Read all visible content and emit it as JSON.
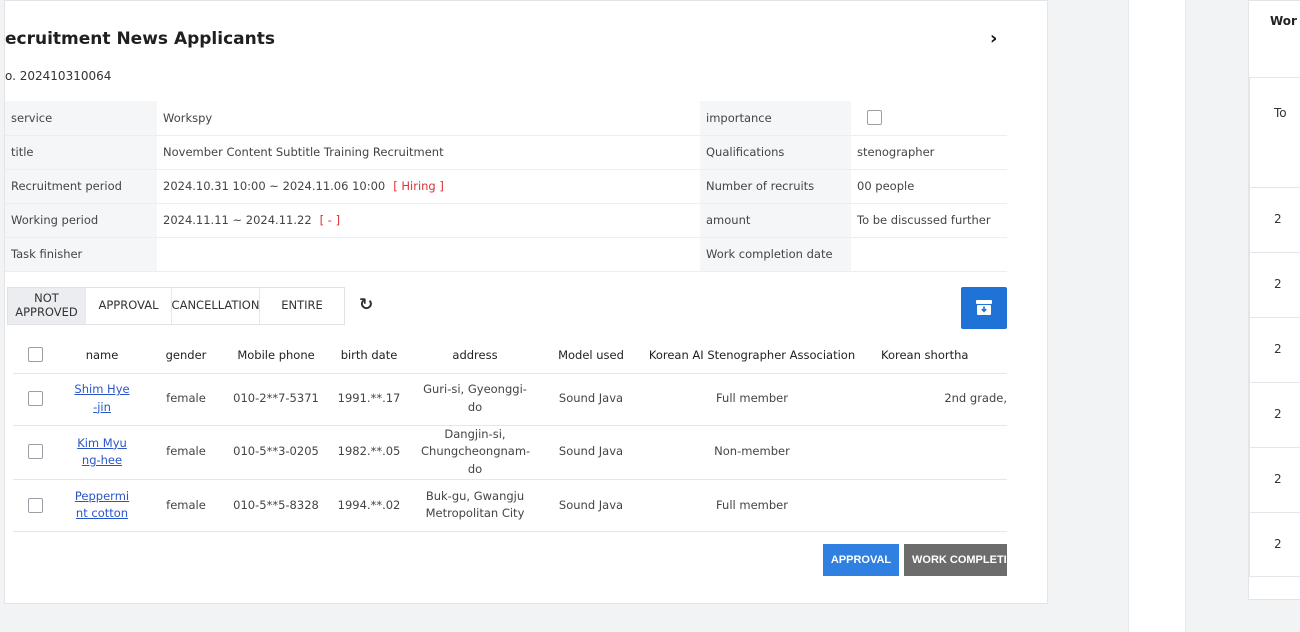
{
  "dialog": {
    "title": "ecruitment News Applicants",
    "request_no": "o. 202410310064",
    "close_icon": "close-icon"
  },
  "info": {
    "rows": [
      {
        "label": "service",
        "value": "Workspy",
        "right_label": "importance",
        "right_value": ""
      },
      {
        "label": "title",
        "value": "November Content Subtitle Training Recruitment",
        "right_label": "Qualifications",
        "right_value": "stenographer"
      },
      {
        "label": "Recruitment period",
        "value": "2024.10.31 10:00 ~ 2024.11.06 10:00",
        "tag": "[ Hiring ]",
        "right_label": "Number of recruits",
        "right_value": "00 people"
      },
      {
        "label": "Working period",
        "value": "2024.11.11 ~ 2024.11.22",
        "tag": "[ - ]",
        "right_label": "amount",
        "right_value": "To be discussed further"
      },
      {
        "label": "Task finisher",
        "value": "",
        "right_label": "Work completion date",
        "right_value": ""
      }
    ],
    "importance_checked": false
  },
  "filter_tabs": [
    {
      "label": "NOT APPROVED",
      "active": true
    },
    {
      "label": "APPROVAL",
      "active": false
    },
    {
      "label": "CANCELLATION",
      "active": false
    },
    {
      "label": "ENTIRE",
      "active": false
    }
  ],
  "refresh_icon": "refresh-icon",
  "download_icon": "archive-download-icon",
  "download_color": "#1f73d6",
  "applicants": {
    "columns": [
      "name",
      "gender",
      "Mobile phone",
      "birth date",
      "address",
      "Model used",
      "Korean AI Stenographer Association",
      "Korean shortha"
    ],
    "rows": [
      {
        "name": "Shim Hye-jin",
        "gender": "female",
        "phone": "010-2**7-5371",
        "birth": "1991.**.17",
        "address": "Guri-si, Gyeonggi-do",
        "model": "Sound Java",
        "association": "Full member",
        "shorthand": "2nd grade,"
      },
      {
        "name": "Kim Myung-hee",
        "gender": "female",
        "phone": "010-5**3-0205",
        "birth": "1982.**.05",
        "address": "Dangjin-si, Chungcheongnam-do",
        "model": "Sound Java",
        "association": "Non-member",
        "shorthand": ""
      },
      {
        "name": "Peppermint cotton",
        "gender": "female",
        "phone": "010-5**5-8328",
        "birth": "1994.**.02",
        "address": "Buk-gu, Gwangju Metropolitan City",
        "model": "Sound Java",
        "association": "Full member",
        "shorthand": ""
      }
    ]
  },
  "actions": {
    "approve": "APPROVAL",
    "work_complete": "WORK COMPLETI",
    "approve_color": "#2f80e0",
    "complete_color": "#6c6c6c"
  },
  "side_panel": {
    "title": "Wor stat",
    "header_cell": "To",
    "rows": [
      "2",
      "2",
      "2",
      "2",
      "2",
      "2"
    ]
  }
}
